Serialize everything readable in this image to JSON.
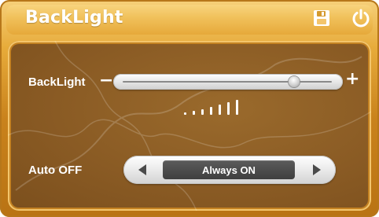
{
  "window": {
    "title": "BackLight",
    "buttons": {
      "save": {
        "icon": "save-icon"
      },
      "power": {
        "icon": "power-icon"
      }
    }
  },
  "backlight": {
    "label": "BackLight",
    "decrease_label": "−",
    "increase_label": "+",
    "level": 0.82,
    "max_level": 7
  },
  "auto_off": {
    "label": "Auto OFF",
    "value": "Always ON",
    "prev_icon": "triangle-left-icon",
    "next_icon": "triangle-right-icon"
  },
  "colors": {
    "accent": "#e7ab3a",
    "panel": "#8a5b24",
    "text": "#ffffff"
  }
}
